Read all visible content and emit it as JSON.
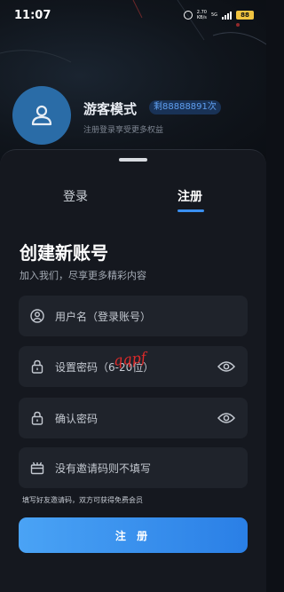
{
  "status_bar": {
    "time": "11:07",
    "speed": "2.70",
    "speed_unit": "KB/s",
    "network": "5G",
    "battery": "88"
  },
  "profile": {
    "title": "游客模式",
    "badge": "剩88888891次",
    "subtitle": "注册登录享受更多权益",
    "avatar_icon": "person-icon"
  },
  "tabs": [
    {
      "label": "登录",
      "active": false
    },
    {
      "label": "注册",
      "active": true
    }
  ],
  "form": {
    "heading": "创建新账号",
    "subheading": "加入我们，尽享更多精彩内容",
    "fields": [
      {
        "placeholder": "用户名（登录账号）",
        "icon": "user-circle-icon"
      },
      {
        "placeholder": "设置密码（6-20位）",
        "icon": "lock-icon",
        "toggle": "eye-icon"
      },
      {
        "placeholder": "确认密码",
        "icon": "lock-icon",
        "toggle": "eye-icon"
      },
      {
        "placeholder": "没有邀请码则不填写",
        "icon": "gift-icon"
      }
    ],
    "hint": "填写好友邀请码，双方可获得免费会员",
    "submit_label": "注 册",
    "annotation": "qqpf"
  },
  "colors": {
    "accent": "#3a8ff0",
    "badge_text": "#5f9ff0",
    "background": "#0d1016",
    "sheet": "#15181f",
    "field": "#1f232b"
  }
}
